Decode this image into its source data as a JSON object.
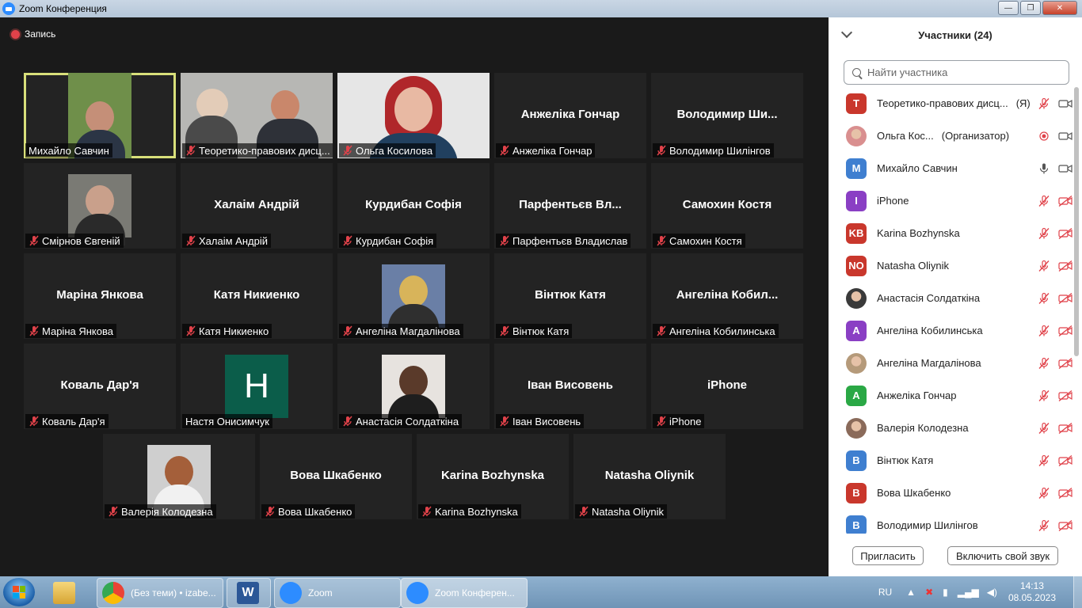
{
  "window": {
    "title": "Zoom Конференция",
    "buttons": {
      "minimize": "—",
      "maximize": "❐",
      "close": "✕"
    }
  },
  "recording": {
    "label": "Запись"
  },
  "tiles": [
    {
      "label": "Михайло Савчин",
      "big": "",
      "muted": false,
      "photo": "m1",
      "active": true
    },
    {
      "label": "Теоретико-правових дисц...",
      "big": "",
      "muted": true,
      "photo": "group"
    },
    {
      "label": "Ольга Косилова",
      "big": "",
      "muted": true,
      "photo": "olga"
    },
    {
      "label": "Анжеліка Гончар",
      "big": "Анжеліка Гончар",
      "muted": true
    },
    {
      "label": "Володимир Шилінгов",
      "big": "Володимир  Ши...",
      "muted": true
    },
    {
      "label": "Смірнов Євгеній",
      "big": "",
      "muted": true,
      "photo": "m2"
    },
    {
      "label": "Халаім Андрій",
      "big": "Халаім Андрій",
      "muted": true
    },
    {
      "label": "Курдибан Софія",
      "big": "Курдибан Софія",
      "muted": true
    },
    {
      "label": "Парфентьєв Владислав",
      "big": "Парфентьєв Вл...",
      "muted": true
    },
    {
      "label": "Самохин Костя",
      "big": "Самохин Костя",
      "muted": true
    },
    {
      "label": "Маріна Янкова",
      "big": "Маріна Янкова",
      "muted": true
    },
    {
      "label": "Катя Никиенко",
      "big": "Катя Никиенко",
      "muted": true
    },
    {
      "label": "Ангеліна Магдалінова",
      "big": "",
      "muted": true,
      "photo": "f1"
    },
    {
      "label": "Вінтюк Катя",
      "big": "Вінтюк Катя",
      "muted": true
    },
    {
      "label": "Ангеліна Кобилинська",
      "big": "Ангеліна  Кобил...",
      "muted": true
    },
    {
      "label": "Коваль Дар'я",
      "big": "Коваль Дар'я",
      "muted": true
    },
    {
      "label": "Настя Онисимчук",
      "big": "",
      "muted": false,
      "initial": "H"
    },
    {
      "label": "Анастасія Солдаткіна",
      "big": "",
      "muted": true,
      "photo": "f2"
    },
    {
      "label": "Іван Висовень",
      "big": "Іван Висовень",
      "muted": true
    },
    {
      "label": "iPhone",
      "big": "iPhone",
      "muted": true
    },
    {
      "label": "Валерія Колодезна",
      "big": "",
      "muted": true,
      "photo": "f3"
    },
    {
      "label": "Вова Шкабенко",
      "big": "Вова Шкабенко",
      "muted": true
    },
    {
      "label": "Karina Bozhynska",
      "big": "Karina Bozhynska",
      "muted": true
    },
    {
      "label": "Natasha Oliynik",
      "big": "Natasha Oliynik",
      "muted": true
    }
  ],
  "panel": {
    "title": "Участники (24)",
    "search_placeholder": "Найти участника",
    "invite": "Пригласить",
    "unmute_self": "Включить свой звук",
    "participants": [
      {
        "initials": "T",
        "color": "#c9372c",
        "name": "Теоретико-правових дисц...",
        "tag": "(Я)",
        "mic": "muted",
        "video": "on"
      },
      {
        "initials": "",
        "color": "#d98f8f",
        "name": "Ольга Кос...",
        "tag": "(Организатор)",
        "mic": "recording",
        "video": "on",
        "photo": true
      },
      {
        "initials": "M",
        "color": "#3f7fd0",
        "name": "Михайло Савчин",
        "tag": "",
        "mic": "on",
        "video": "on"
      },
      {
        "initials": "I",
        "color": "#8a3fc4",
        "name": "iPhone",
        "tag": "",
        "mic": "muted",
        "video": "off"
      },
      {
        "initials": "KB",
        "color": "#c9372c",
        "name": "Karina Bozhynska",
        "tag": "",
        "mic": "muted",
        "video": "off"
      },
      {
        "initials": "NO",
        "color": "#c9372c",
        "name": "Natasha Oliynik",
        "tag": "",
        "mic": "muted",
        "video": "off"
      },
      {
        "initials": "",
        "color": "#3a3a3a",
        "name": "Анастасія Солдаткіна",
        "tag": "",
        "mic": "muted",
        "video": "off",
        "photo": true
      },
      {
        "initials": "A",
        "color": "#8a3fc4",
        "name": "Ангеліна Кобилинська",
        "tag": "",
        "mic": "muted",
        "video": "off"
      },
      {
        "initials": "",
        "color": "#b59a7a",
        "name": "Ангеліна Магдалінова",
        "tag": "",
        "mic": "muted",
        "video": "off",
        "photo": true
      },
      {
        "initials": "A",
        "color": "#2aa845",
        "name": "Анжеліка Гончар",
        "tag": "",
        "mic": "muted",
        "video": "off"
      },
      {
        "initials": "",
        "color": "#8a6a5a",
        "name": "Валерія Колодезна",
        "tag": "",
        "mic": "muted",
        "video": "off",
        "photo": true
      },
      {
        "initials": "B",
        "color": "#3f7fd0",
        "name": "Вінтюк Катя",
        "tag": "",
        "mic": "muted",
        "video": "off"
      },
      {
        "initials": "B",
        "color": "#c9372c",
        "name": "Вова Шкабенко",
        "tag": "",
        "mic": "muted",
        "video": "off"
      },
      {
        "initials": "B",
        "color": "#3f7fd0",
        "name": "Володимир Шилінгов",
        "tag": "",
        "mic": "muted",
        "video": "off"
      }
    ]
  },
  "taskbar": {
    "apps": [
      {
        "label": "(Без теми) • izabe...",
        "icon": "chrome-icon"
      },
      {
        "label": "",
        "icon": "word-icon"
      },
      {
        "label": "Zoom",
        "icon": "zoom-icon"
      },
      {
        "label": "Zoom Конферен...",
        "icon": "zoom-icon"
      }
    ],
    "lang": "RU",
    "time": "14:13",
    "date": "08.05.2023"
  },
  "colors": {
    "active_border": "#d8df7a",
    "muted_red": "#e0424a",
    "tile_bg": "#232323",
    "stage_bg": "#1a1a1a"
  }
}
